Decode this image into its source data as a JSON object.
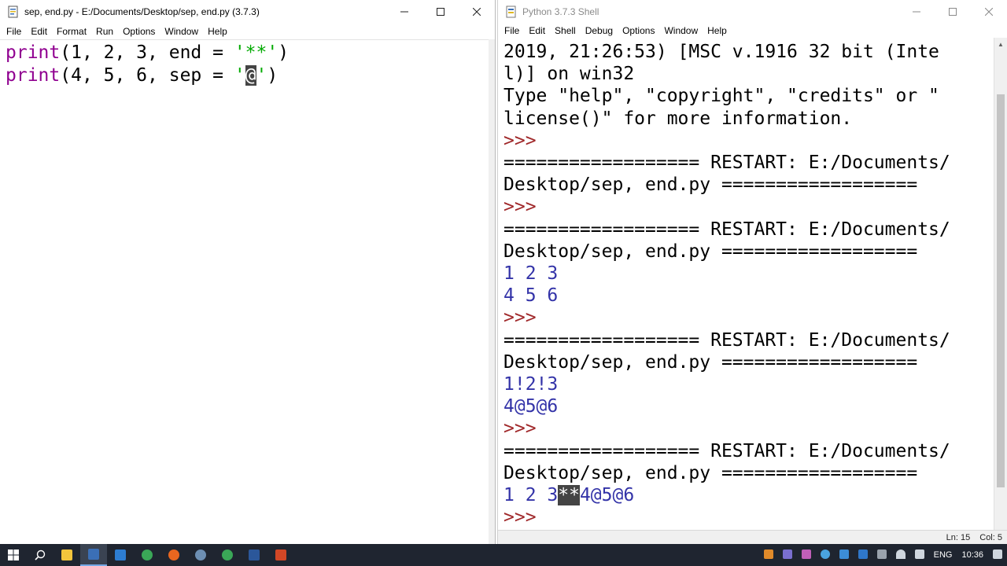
{
  "editor": {
    "title": "sep, end.py - E:/Documents/Desktop/sep, end.py (3.7.3)",
    "menu": [
      "File",
      "Edit",
      "Format",
      "Run",
      "Options",
      "Window",
      "Help"
    ],
    "code": {
      "line1": {
        "kw": "print",
        "args": "(1, 2, 3, end = ",
        "str": "'**'",
        "close": ")"
      },
      "line2": {
        "kw": "print",
        "args": "(4, 5, 6, sep = ",
        "q1": "'",
        "selected": "@",
        "q2": "'",
        "close": ")"
      }
    }
  },
  "shell": {
    "title": "Python 3.7.3 Shell",
    "menu": [
      "File",
      "Edit",
      "Shell",
      "Debug",
      "Options",
      "Window",
      "Help"
    ],
    "lines": {
      "l1": "2019, 21:26:53) [MSC v.1916 32 bit (Inte",
      "l2": "l)] on win32",
      "l3": "Type \"help\", \"copyright\", \"credits\" or \"",
      "l4": "license()\" for more information.",
      "prompt": ">>>",
      "restart_a": "================== RESTART: E:/Documents/",
      "restart_b": "Desktop/sep, end.py ==================",
      "out1a": "1 2 3",
      "out1b": "4 5 6",
      "out2a": "1!2!3",
      "out2b": "4@5@6",
      "out3_pre": "1 2 3",
      "out3_sel": "**",
      "out3_post": "4@5@6"
    },
    "status": {
      "ln": "Ln: 15",
      "col": "Col: 5"
    }
  },
  "taskbar": {
    "tray": {
      "lang": "ENG",
      "time": "10:36"
    }
  },
  "colors": {
    "keyword": "#900090",
    "string": "#00aa00",
    "output": "#3333a8",
    "prompt": "#a0282a",
    "taskbar": "#1f2530"
  }
}
